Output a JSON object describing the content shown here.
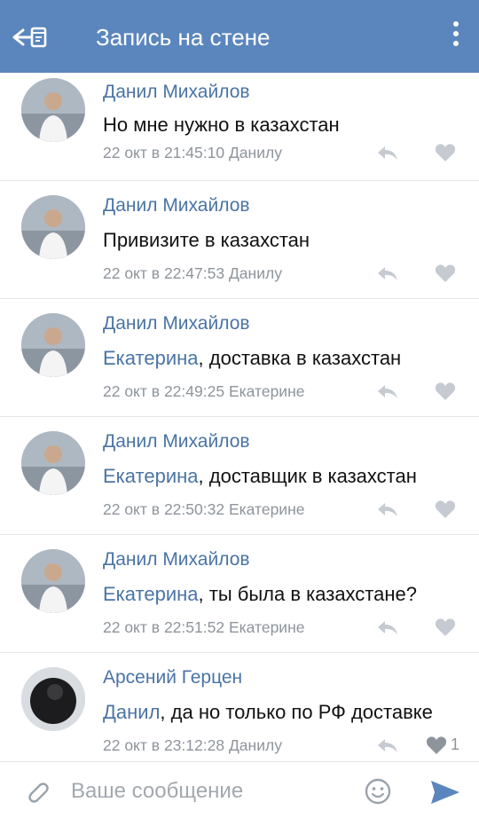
{
  "header": {
    "title": "Запись на стене",
    "back_icon": "back-arrow-with-post-icon",
    "menu_icon": "more-vertical-icon",
    "color": "#5b86bd"
  },
  "comments": [
    {
      "author": "Данил Михайлов",
      "mention": "",
      "text": "Но мне нужно в казахстан",
      "timestamp": "22 окт в 21:45:10",
      "reply_to": "Данилу",
      "likes": ""
    },
    {
      "author": "Данил Михайлов",
      "mention": "",
      "text": "Привизите в казахстан",
      "timestamp": "22 окт в 22:47:53",
      "reply_to": "Данилу",
      "likes": ""
    },
    {
      "author": "Данил Михайлов",
      "mention": "Екатерина",
      "text": ", доставка в казахстан",
      "timestamp": "22 окт в 22:49:25",
      "reply_to": "Екатерине",
      "likes": ""
    },
    {
      "author": "Данил Михайлов",
      "mention": "Екатерина",
      "text": ", доставщик в казахстан",
      "timestamp": "22 окт в 22:50:32",
      "reply_to": "Екатерине",
      "likes": ""
    },
    {
      "author": "Данил Михайлов",
      "mention": "Екатерина",
      "text": ", ты была в казахстане?",
      "timestamp": "22 окт в 22:51:52",
      "reply_to": "Екатерине",
      "likes": ""
    },
    {
      "author": "Арсений Герцен",
      "mention": "Данил",
      "text": ", да но только по РФ доставке",
      "timestamp": "22 окт в 23:12:28",
      "reply_to": "Данилу",
      "likes": "1"
    }
  ],
  "composer": {
    "placeholder": "Ваше сообщение",
    "attach_icon": "paperclip-icon",
    "emoji_icon": "smiley-icon",
    "send_icon": "send-icon"
  },
  "colors": {
    "link": "#4a74a5",
    "meta": "#8e949b",
    "divider": "#e3e6ea"
  }
}
